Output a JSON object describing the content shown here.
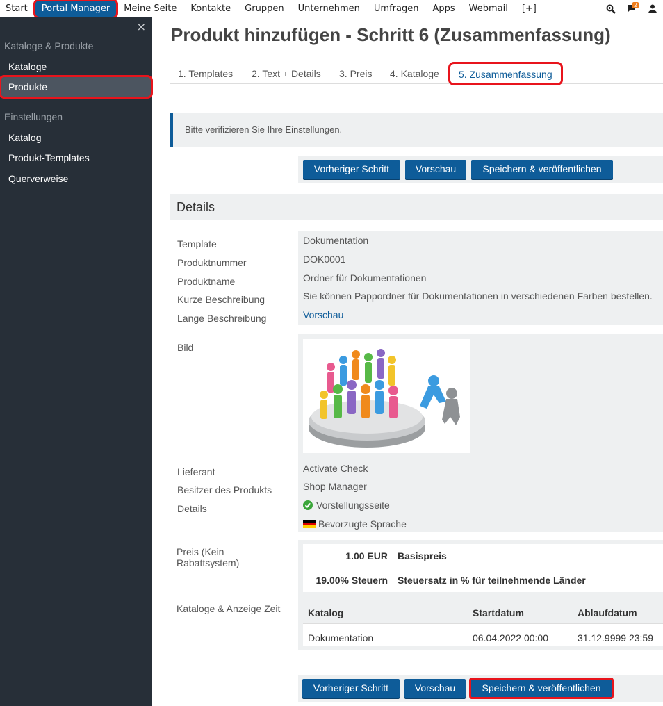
{
  "topnav": {
    "items": [
      "Start",
      "Portal Manager",
      "Meine Seite",
      "Kontakte",
      "Gruppen",
      "Unternehmen",
      "Umfragen",
      "Apps",
      "Webmail",
      "[+]"
    ],
    "notification_count": "2",
    "icons": [
      "search-icon",
      "chat-icon",
      "user-icon"
    ]
  },
  "sidebar": {
    "close": "×",
    "section1": "Kataloge & Produkte",
    "items1": [
      "Kataloge",
      "Produkte"
    ],
    "section2": "Einstellungen",
    "items2": [
      "Katalog",
      "Produkt-Templates",
      "Querverweise"
    ]
  },
  "page": {
    "title": "Produkt hinzufügen - Schritt 6 (Zusammenfassung)",
    "tabs": [
      "1. Templates",
      "2. Text + Details",
      "3. Preis",
      "4. Kataloge",
      "5. Zusammenfassung"
    ],
    "alert": "Bitte verifizieren Sie Ihre Einstellungen.",
    "buttons": {
      "prev": "Vorheriger Schritt",
      "preview": "Vorschau",
      "save": "Speichern & veröffentlichen"
    },
    "details_title": "Details"
  },
  "details": {
    "template_label": "Template",
    "template_value": "Dokumentation",
    "number_label": "Produktnummer",
    "number_value": "DOK0001",
    "name_label": "Produktname",
    "name_value": "Ordner für Dokumentationen",
    "short_label": "Kurze Beschreibung",
    "short_value": "Sie können Pappordner für Dokumentationen in verschiedenen Farben bestellen.",
    "long_label": "Lange Beschreibung",
    "long_value": "Vorschau",
    "image_label": "Bild",
    "supplier_label": "Lieferant",
    "supplier_value": "Activate Check",
    "owner_label": "Besitzer des Produkts",
    "owner_value": "Shop Manager",
    "details_label": "Details",
    "details_value1": "Vorstellungsseite",
    "details_value2": "Bevorzugte Sprache"
  },
  "price": {
    "label": "Preis (Kein Rabattsystem)",
    "rows": [
      {
        "amount": "1.00 EUR",
        "desc": "Basispreis"
      },
      {
        "amount": "19.00% Steuern",
        "desc": "Steuersatz in % für teilnehmende Länder"
      }
    ]
  },
  "catalogs": {
    "label": "Kataloge & Anzeige Zeit",
    "headers": [
      "Katalog",
      "Startdatum",
      "Ablaufdatum"
    ],
    "row": [
      "Dokumentation",
      "06.04.2022 00:00",
      "31.12.9999 23:59"
    ]
  }
}
